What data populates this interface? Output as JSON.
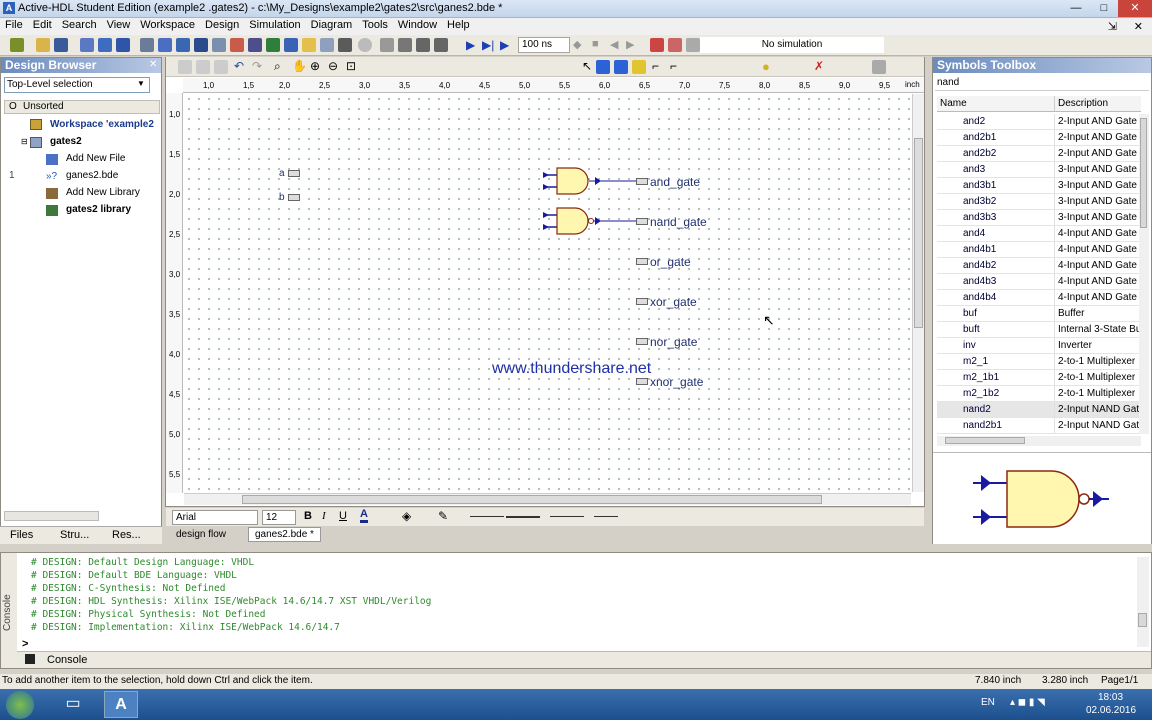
{
  "window": {
    "title": "Active-HDL Student Edition (example2 .gates2) - c:\\My_Designs\\example2\\gates2\\src\\ganes2.bde *",
    "minimize": "—",
    "maximize": "□",
    "close": "✕"
  },
  "menu": [
    "File",
    "Edit",
    "Search",
    "View",
    "Workspace",
    "Design",
    "Simulation",
    "Diagram",
    "Tools",
    "Window",
    "Help"
  ],
  "toolbar": {
    "sim_time": "100 ns",
    "sim_status": "No simulation"
  },
  "design_browser": {
    "title": "Design Browser",
    "selection": "Top-Level selection",
    "col_o": "O",
    "col_sort": "Unsorted",
    "tree": [
      {
        "label": "Workspace 'example2",
        "bold": true
      },
      {
        "label": "gates2",
        "bold": true
      },
      {
        "label": "Add New File",
        "bold": false
      },
      {
        "label": "ganes2.bde",
        "bold": false,
        "marker": "1"
      },
      {
        "label": "Add New Library",
        "bold": false
      },
      {
        "label": "gates2 library",
        "bold": true
      }
    ],
    "tabs": [
      "Files",
      "Stru...",
      "Res..."
    ]
  },
  "ruler": {
    "h": [
      "1,0",
      "1,5",
      "2,0",
      "2,5",
      "3,0",
      "3,5",
      "4,0",
      "4,5",
      "5,0",
      "5,5",
      "6,0",
      "6,5",
      "7,0",
      "7,5",
      "8,0",
      "8,5",
      "9,0",
      "9,5"
    ],
    "unit": "inch",
    "v": [
      "1,0",
      "1,5",
      "2,0",
      "2,5",
      "3,0",
      "3,5",
      "4,0",
      "4,5",
      "5,0",
      "5,5"
    ]
  },
  "schematic": {
    "inputs": [
      "a",
      "b"
    ],
    "outputs": [
      "and_gate",
      "nand_gate",
      "or_gate",
      "xor_gate",
      "nor_gate",
      "xnor_gate"
    ],
    "watermark": "www.thundershare.net"
  },
  "fontbar": {
    "font": "Arial",
    "size": "12",
    "bold": "B",
    "italic": "I",
    "underline": "U"
  },
  "doc_tabs": [
    "design flow",
    "ganes2.bde *"
  ],
  "symbols": {
    "title": "Symbols Toolbox",
    "search": "nand",
    "col_name": "Name",
    "col_desc": "Description",
    "rows": [
      {
        "name": "and2",
        "desc": "2-Input AND Gate"
      },
      {
        "name": "and2b1",
        "desc": "2-Input AND Gate"
      },
      {
        "name": "and2b2",
        "desc": "2-Input AND Gate"
      },
      {
        "name": "and3",
        "desc": "3-Input AND Gate"
      },
      {
        "name": "and3b1",
        "desc": "3-Input AND Gate"
      },
      {
        "name": "and3b2",
        "desc": "3-Input AND Gate"
      },
      {
        "name": "and3b3",
        "desc": "3-Input AND Gate"
      },
      {
        "name": "and4",
        "desc": "4-Input AND Gate"
      },
      {
        "name": "and4b1",
        "desc": "4-Input AND Gate"
      },
      {
        "name": "and4b2",
        "desc": "4-Input AND Gate"
      },
      {
        "name": "and4b3",
        "desc": "4-Input AND Gate"
      },
      {
        "name": "and4b4",
        "desc": "4-Input AND Gate"
      },
      {
        "name": "buf",
        "desc": "Buffer"
      },
      {
        "name": "buft",
        "desc": "Internal 3-State Bu"
      },
      {
        "name": "inv",
        "desc": "Inverter"
      },
      {
        "name": "m2_1",
        "desc": "2-to-1 Multiplexer"
      },
      {
        "name": "m2_1b1",
        "desc": "2-to-1 Multiplexer"
      },
      {
        "name": "m2_1b2",
        "desc": "2-to-1 Multiplexer"
      },
      {
        "name": "nand2",
        "desc": "2-Input NAND Gat"
      },
      {
        "name": "nand2b1",
        "desc": "2-Input NAND Gat"
      }
    ]
  },
  "console": {
    "lines": [
      "# DESIGN: Default Design Language: VHDL",
      "# DESIGN: Default BDE Language: VHDL",
      "# DESIGN: C-Synthesis: Not Defined",
      "# DESIGN: HDL Synthesis: Xilinx ISE/WebPack 14.6/14.7 XST VHDL/Verilog",
      "# DESIGN: Physical Synthesis: Not Defined",
      "# DESIGN: Implementation: Xilinx ISE/WebPack 14.6/14.7"
    ],
    "prompt": ">",
    "side_label": "Console",
    "tab": "Console"
  },
  "status": {
    "hint": "To add another item to the selection, hold down Ctrl and click the item.",
    "x": "7.840 inch",
    "y": "3.280 inch",
    "page": "Page1/1"
  },
  "taskbar": {
    "lang": "EN",
    "time": "18:03",
    "date": "02.06.2016",
    "app_letter": "A"
  }
}
